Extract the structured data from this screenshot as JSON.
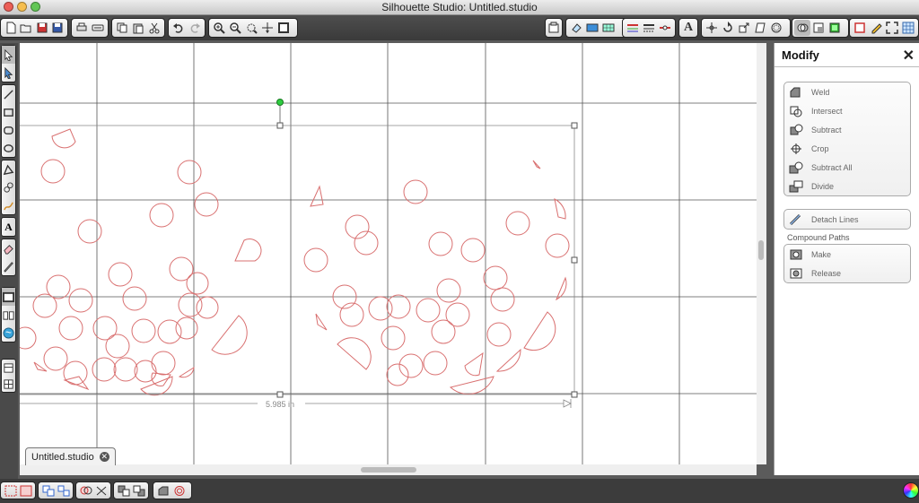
{
  "window": {
    "title": "Silhouette Studio: Untitled.studio"
  },
  "canvas": {
    "dimension_label": "5.985 in"
  },
  "document_tab": {
    "label": "Untitled.studio"
  },
  "panel": {
    "title": "Modify",
    "modify_items": [
      {
        "label": "Weld",
        "icon": "weld-icon"
      },
      {
        "label": "Intersect",
        "icon": "intersect-icon"
      },
      {
        "label": "Subtract",
        "icon": "subtract-icon"
      },
      {
        "label": "Crop",
        "icon": "crop-icon"
      },
      {
        "label": "Subtract All",
        "icon": "subtract-all-icon"
      },
      {
        "label": "Divide",
        "icon": "divide-icon"
      }
    ],
    "detach": {
      "label": "Detach Lines",
      "icon": "detach-lines-icon"
    },
    "compound_paths": {
      "label": "Compound Paths",
      "items": [
        {
          "label": "Make",
          "icon": "make-compound-icon"
        },
        {
          "label": "Release",
          "icon": "release-compound-icon"
        }
      ]
    }
  },
  "colors": {
    "accent_green": "#2ecc40",
    "shape_stroke": "#d97070",
    "grid": "#555555"
  }
}
